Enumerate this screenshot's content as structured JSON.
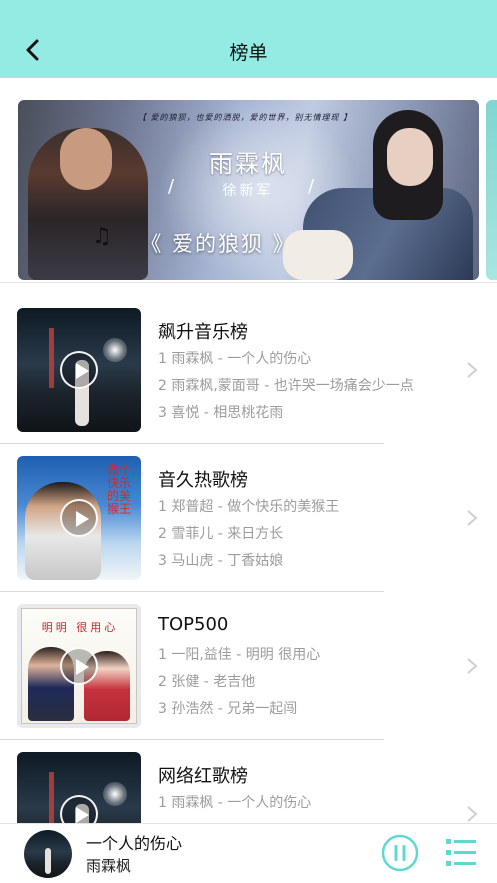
{
  "header": {
    "title": "榜单"
  },
  "banner": {
    "top_text": "【 爱的狼狈，也爱的洒脱，爱的世界，别无情理现 】",
    "singer": "雨霖枫",
    "lyricist": "徐新军",
    "song": "《 爱的狼狈 》"
  },
  "ranks": [
    {
      "title": "飙升音乐榜",
      "lines": [
        "1 雨霖枫 - 一个人的伤心",
        "2 雨霖枫,蒙面哥 - 也许哭一场痛会少一点",
        "3 喜悦 - 相思桃花雨"
      ]
    },
    {
      "title": "音久热歌榜",
      "lines": [
        "1 郑普超 - 做个快乐的美猴王",
        "2 雪菲儿 - 来日方长",
        "3 马山虎 - 丁香姑娘"
      ]
    },
    {
      "title": "TOP500",
      "lines": [
        "1 一阳,益佳 - 明明 很用心",
        "2 张健 - 老吉他",
        "3 孙浩然 - 兄弟一起闯"
      ]
    },
    {
      "title": "网络红歌榜",
      "lines": [
        "1 雨霖枫 - 一个人的伤心",
        "",
        ""
      ]
    }
  ],
  "covers": {
    "sky_text": "做个快乐的美猴王",
    "poster_title": "明明 很用心"
  },
  "player": {
    "title": "一个人的伤心",
    "artist": "雨霖枫"
  },
  "colors": {
    "header_bg": "#94ebe4",
    "accent": "#5fd9d0",
    "text_primary": "#111111",
    "text_secondary": "#9c9c9c"
  },
  "icons": {
    "back": "back-arrow-icon",
    "play": "play-icon",
    "chevron": "chevron-right-icon",
    "pause": "pause-icon",
    "playlist": "playlist-icon"
  }
}
